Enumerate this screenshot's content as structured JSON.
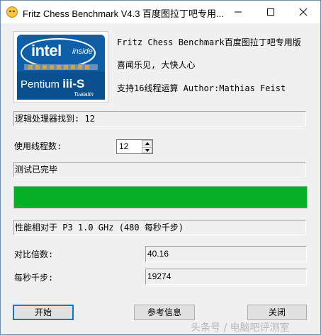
{
  "window": {
    "title": "Fritz Chess Benchmark V4.3  百度图拉丁吧专用...",
    "controls": {
      "minimize_icon": "minimize-icon",
      "maximize_icon": "maximize-icon",
      "close_icon": "close-icon"
    }
  },
  "logo": {
    "brand": "intel",
    "tagline": "inside",
    "product_prefix": "Pentium ",
    "product_suffix": "iii-S",
    "codename": "Tualatin"
  },
  "info": {
    "line1": "Fritz Chess Benchmark百度图拉丁吧专用版",
    "line2": "喜闻乐见, 大快人心",
    "line3": "支持16线程运算   Author:Mathias Feist"
  },
  "processors_found": "逻辑处理器找到: 12",
  "threads": {
    "label": "使用线程数:",
    "value": "12"
  },
  "status": "测试已完毕",
  "progress": {
    "percent": 100,
    "color": "#06b025"
  },
  "relative_performance": "性能相对于 P3 1.0 GHz (480 每秒千步)",
  "ratio": {
    "label": "对比倍数:",
    "value": "40.16"
  },
  "knps": {
    "label": "每秒千步:",
    "value": "19274"
  },
  "buttons": {
    "start": "开始",
    "reference": "参考信息",
    "close": "关闭"
  },
  "watermark": "头条号 / 电脑吧评测室",
  "colors": {
    "intel_blue": "#0d5fa8",
    "accent": "#0078d7"
  }
}
